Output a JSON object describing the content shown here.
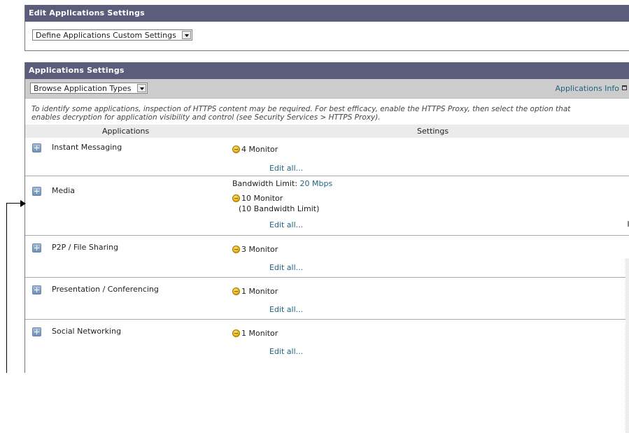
{
  "edit_panel": {
    "title": "Edit Applications Settings",
    "mode_select": "Define Applications Custom Settings"
  },
  "apps_panel": {
    "title": "Applications Settings",
    "browse_select": "Browse Application Types",
    "info_link": "Applications Info",
    "note_line1": "To identify some applications, inspection of HTTPS content may be required. For best efficacy, enable the HTTPS Proxy, then select the option that",
    "note_line2": "enables decryption for application visibility and control (see Security Services > HTTPS Proxy).",
    "col_applications": "Applications",
    "col_settings": "Settings",
    "edit_all_label": "Edit all...",
    "rows": [
      {
        "name": "Instant Messaging",
        "status": "4 Monitor"
      },
      {
        "name": "Media",
        "bandwidth_label": "Bandwidth Limit:",
        "bandwidth_value": "20 Mbps",
        "status": "10 Monitor",
        "sub": "(10 Bandwidth Limit)"
      },
      {
        "name": "P2P / File Sharing",
        "status": "3 Monitor"
      },
      {
        "name": "Presentation / Conferencing",
        "status": "1 Monitor"
      },
      {
        "name": "Social Networking",
        "status": "1 Monitor"
      }
    ]
  },
  "colors": {
    "header_bg": "#5c5d7a",
    "toolbar_bg": "#cccccc",
    "link": "#21647f",
    "monitor_dot": "#e2a800"
  }
}
